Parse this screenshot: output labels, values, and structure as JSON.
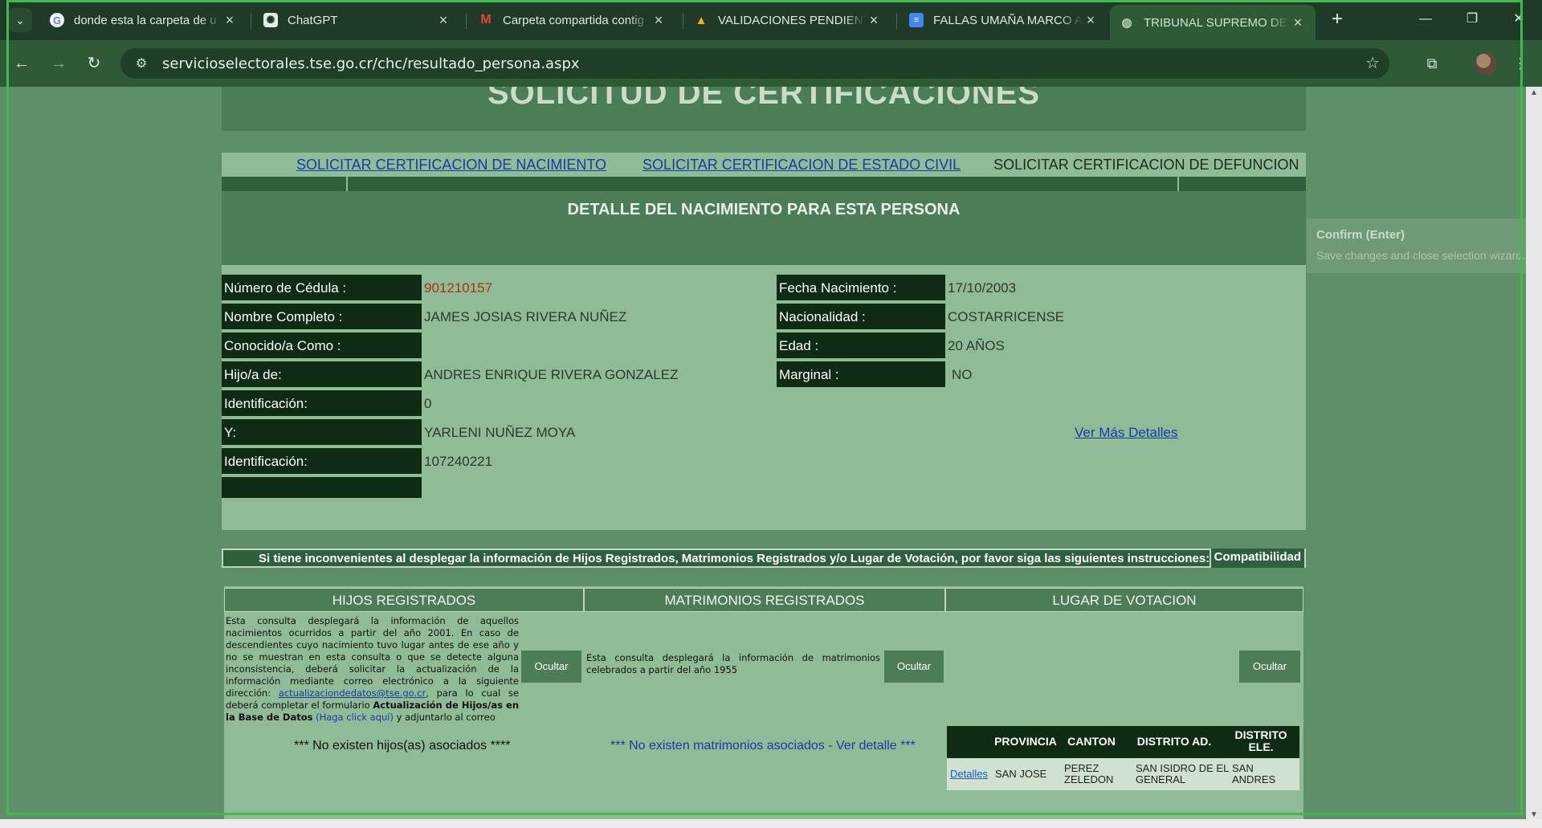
{
  "browser": {
    "tabs": [
      {
        "title": "donde esta la carpeta de u",
        "icon": "google-icon"
      },
      {
        "title": "ChatGPT",
        "icon": "chatgpt-icon"
      },
      {
        "title": "Carpeta compartida contig",
        "icon": "gmail-icon"
      },
      {
        "title": "VALIDACIONES PENDIENTE",
        "icon": "drive-icon"
      },
      {
        "title": "FALLAS UMAÑA MARCO A",
        "icon": "docs-icon"
      },
      {
        "title": "TRIBUNAL SUPREMO DE E",
        "icon": "globe-icon",
        "active": true
      }
    ],
    "url": "servicioselectorales.tse.go.cr/chc/resultado_persona.aspx"
  },
  "page": {
    "banner_title": "SOLICITUD DE CERTIFICACIONES",
    "nav": {
      "nacimiento": "SOLICITAR CERTIFICACION DE NACIMIENTO",
      "estado_civil": "SOLICITAR CERTIFICACION DE ESTADO CIVIL",
      "defuncion": "SOLICITAR CERTIFICACION DE DEFUNCION"
    },
    "detail_title": "DETALLE DEL NACIMIENTO PARA ESTA PERSONA",
    "left_fields": [
      {
        "label": "Número de Cédula :",
        "value": "901210157"
      },
      {
        "label": "Nombre Completo :",
        "value": "JAMES JOSIAS RIVERA NUÑEZ"
      },
      {
        "label": "Conocido/a Como :",
        "value": ""
      },
      {
        "label": "Hijo/a de:",
        "value": "ANDRES ENRIQUE RIVERA GONZALEZ"
      },
      {
        "label": "Identificación:",
        "value": "0"
      },
      {
        "label": "Y:",
        "value": "YARLENI NUÑEZ MOYA"
      },
      {
        "label": "Identificación:",
        "value": "107240221"
      },
      {
        "label": "",
        "value": ""
      }
    ],
    "right_fields": [
      {
        "label": "Fecha Nacimiento :",
        "value": "17/10/2003"
      },
      {
        "label": "Nacionalidad :",
        "value": "COSTARRICENSE"
      },
      {
        "label": "Edad :",
        "value": "20 AÑOS"
      },
      {
        "label": "Marginal :",
        "value": " NO"
      }
    ],
    "ver_mas": "Ver Más Detalles",
    "compat_message": "Si tiene inconvenientes al desplegar la información de Hijos Registrados, Matrimonios Registrados y/o Lugar de Votación, por favor siga las siguientes instrucciones:",
    "compat_button": "Compatibilidad",
    "hijos": {
      "header": "HIJOS REGISTRADOS",
      "text_1": "Esta consulta desplegará la información de aquellos nacimientos ocurridos a partir del año 2001. En caso de descendientes cuyo nacimiento tuvo lugar antes de ese año y no se muestran en esta consulta o que se detecte alguna inconsistencia, deberá solicitar la actualización de la información mediante correo electrónico a la siguiente dirección:",
      "email": "actualizaciondedatos@tse.go.cr",
      "text_2": ", para lo cual se deberá completar el formulario",
      "form_name": "Actualización de Hijos/as en la Base de Datos",
      "click_here": "(Haga click aquí)",
      "text_3": "y adjuntarlo al correo",
      "button": "Ocultar",
      "empty": "*** No existen hijos(as) asociados ****"
    },
    "matrimonios": {
      "header": "MATRIMONIOS REGISTRADOS",
      "text": "Esta consulta desplegará la información de matrimonios celebrados a partir del año 1955",
      "button": "Ocultar",
      "empty": "*** No existen matrimonios asociados - Ver detalle ***"
    },
    "votacion": {
      "header": "LUGAR DE VOTACION",
      "button": "Ocultar",
      "columns": [
        "PROVINCIA",
        "CANTON",
        "DISTRITO AD.",
        "DISTRITO ELE."
      ],
      "row": {
        "link": "Detalles",
        "provincia": "SAN JOSE",
        "canton": "PEREZ ZELEDON",
        "distrito_ad": "SAN ISIDRO DE EL GENERAL",
        "distrito_ele": "SAN ANDRES"
      }
    }
  },
  "tooltip": {
    "title": "Confirm (Enter)",
    "subtitle": "Save changes and close selection wizard."
  }
}
